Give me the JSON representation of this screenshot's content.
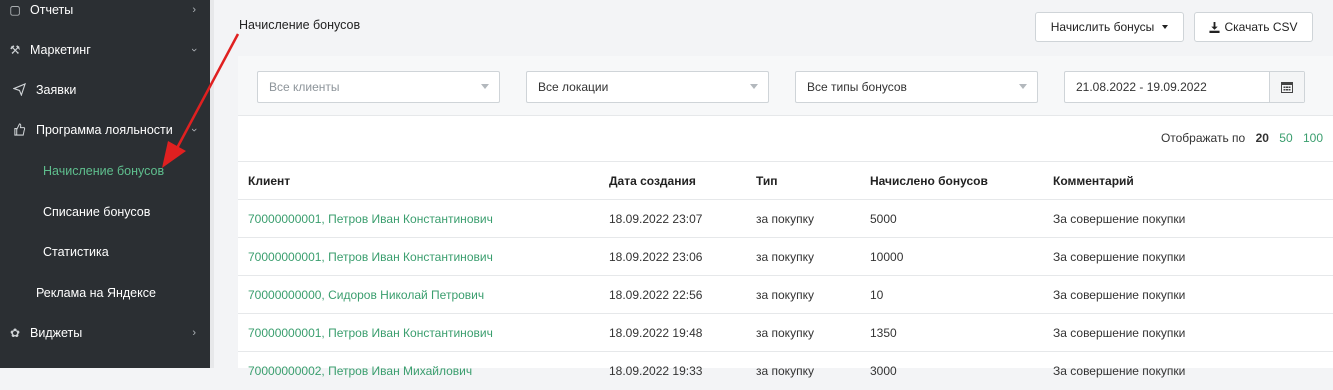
{
  "sidebar": {
    "items": [
      {
        "label": "Отчеты",
        "icon": "reports-icon",
        "arrow": "›"
      },
      {
        "label": "Маркетинг",
        "icon": "wrench-icon",
        "arrow": "›"
      },
      {
        "label": "Заявки",
        "icon": "paper-plane-icon",
        "arrow": ""
      },
      {
        "label": "Программа лояльности",
        "icon": "thumbs-up-icon",
        "arrow": "›"
      },
      {
        "label": "Начисление бонусов",
        "icon": "",
        "arrow": ""
      },
      {
        "label": "Списание бонусов",
        "icon": "",
        "arrow": ""
      },
      {
        "label": "Статистика",
        "icon": "",
        "arrow": ""
      },
      {
        "label": "Реклама на Яндексе",
        "icon": "",
        "arrow": ""
      },
      {
        "label": "Виджеты",
        "icon": "puzzle-icon",
        "arrow": "›"
      }
    ]
  },
  "header": {
    "title": "Начисление бонусов",
    "accrue_button": "Начислить бонусы",
    "download_button": "Скачать CSV"
  },
  "filters": {
    "clients": "Все клиенты",
    "locations": "Все локации",
    "bonus_types": "Все типы бонусов",
    "date_range": "21.08.2022 - 19.09.2022"
  },
  "pagination": {
    "label": "Отображать по",
    "options": [
      "20",
      "50",
      "100"
    ]
  },
  "table": {
    "columns": [
      "Клиент",
      "Дата создания",
      "Тип",
      "Начислено бонусов",
      "Комментарий"
    ],
    "rows": [
      [
        "70000000001, Петров Иван Константинович",
        "18.09.2022 23:07",
        "за покупку",
        "5000",
        "За совершение покупки"
      ],
      [
        "70000000001, Петров Иван Константинович",
        "18.09.2022 23:06",
        "за покупку",
        "10000",
        "За совершение покупки"
      ],
      [
        "70000000000, Сидоров Николай Петрович",
        "18.09.2022 22:56",
        "за покупку",
        "10",
        "За совершение покупки"
      ],
      [
        "70000000001, Петров Иван Константинович",
        "18.09.2022 19:48",
        "за покупку",
        "1350",
        "За совершение покупки"
      ],
      [
        "70000000002, Петров Иван Михайлович",
        "18.09.2022 19:33",
        "за покупку",
        "3000",
        "За совершение покупки"
      ]
    ]
  },
  "colors": {
    "sidebar_bg": "#2b2f33",
    "accent_green": "#3a9e6e",
    "annotation_arrow": "#e02020"
  }
}
